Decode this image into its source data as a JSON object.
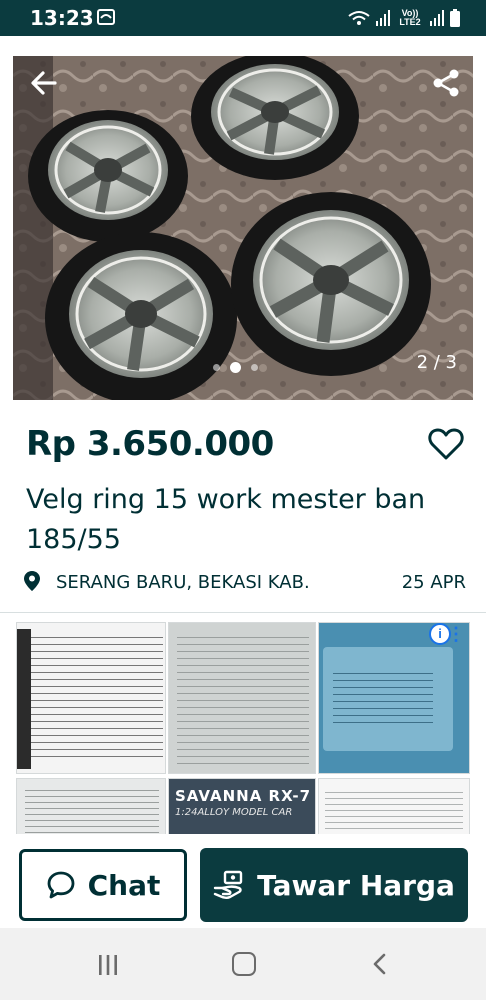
{
  "status_bar": {
    "time": "13:23",
    "volte_label": "Vo)) LTE2"
  },
  "gallery": {
    "counter": "2 / 3",
    "current_index": 2,
    "total": 3
  },
  "listing": {
    "price": "Rp 3.650.000",
    "title": "Velg ring 15 work mester ban 185/55",
    "location": "SERANG BARU, BEKASI KAB.",
    "date": "25 APR"
  },
  "ad": {
    "info_label": "i",
    "menu_label": "⋮",
    "savanna_title": "SAVANNA RX-7",
    "savanna_subtitle": "1:24ALLOY MODEL CAR"
  },
  "actions": {
    "chat_label": "Chat",
    "offer_label": "Tawar Harga"
  },
  "colors": {
    "brand_dark": "#0b3b3f",
    "text_primary": "#002f34"
  },
  "icons": {
    "back": "arrow-left-icon",
    "share": "share-icon",
    "favorite": "heart-outline-icon",
    "location": "location-pin-icon",
    "chat": "chat-bubble-icon",
    "offer": "hand-money-icon"
  }
}
